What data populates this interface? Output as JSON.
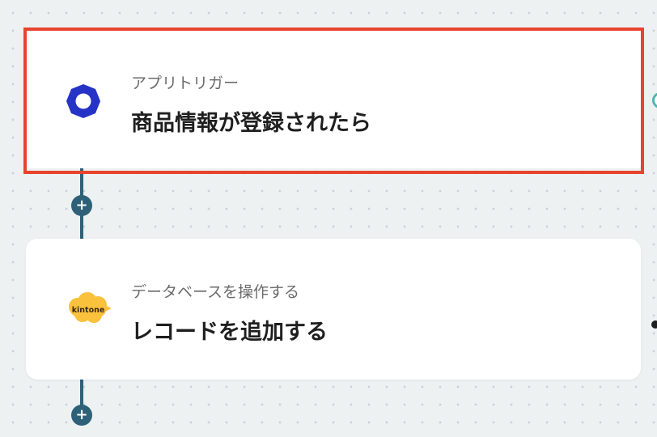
{
  "flow": {
    "steps": [
      {
        "type_label": "アプリトリガー",
        "title": "商品情報が登録されたら",
        "icon": "yoom-ring-icon",
        "selected": true
      },
      {
        "type_label": "データベースを操作する",
        "title": "レコードを追加する",
        "icon": "kintone-logo-icon",
        "icon_text": "kintone",
        "selected": false
      }
    ],
    "add_button_symbol": "+"
  },
  "colors": {
    "connector": "#2e6178",
    "highlight": "#e8432d",
    "trigger_icon": "#2533c7",
    "kintone_cloud": "#f9c13c"
  }
}
